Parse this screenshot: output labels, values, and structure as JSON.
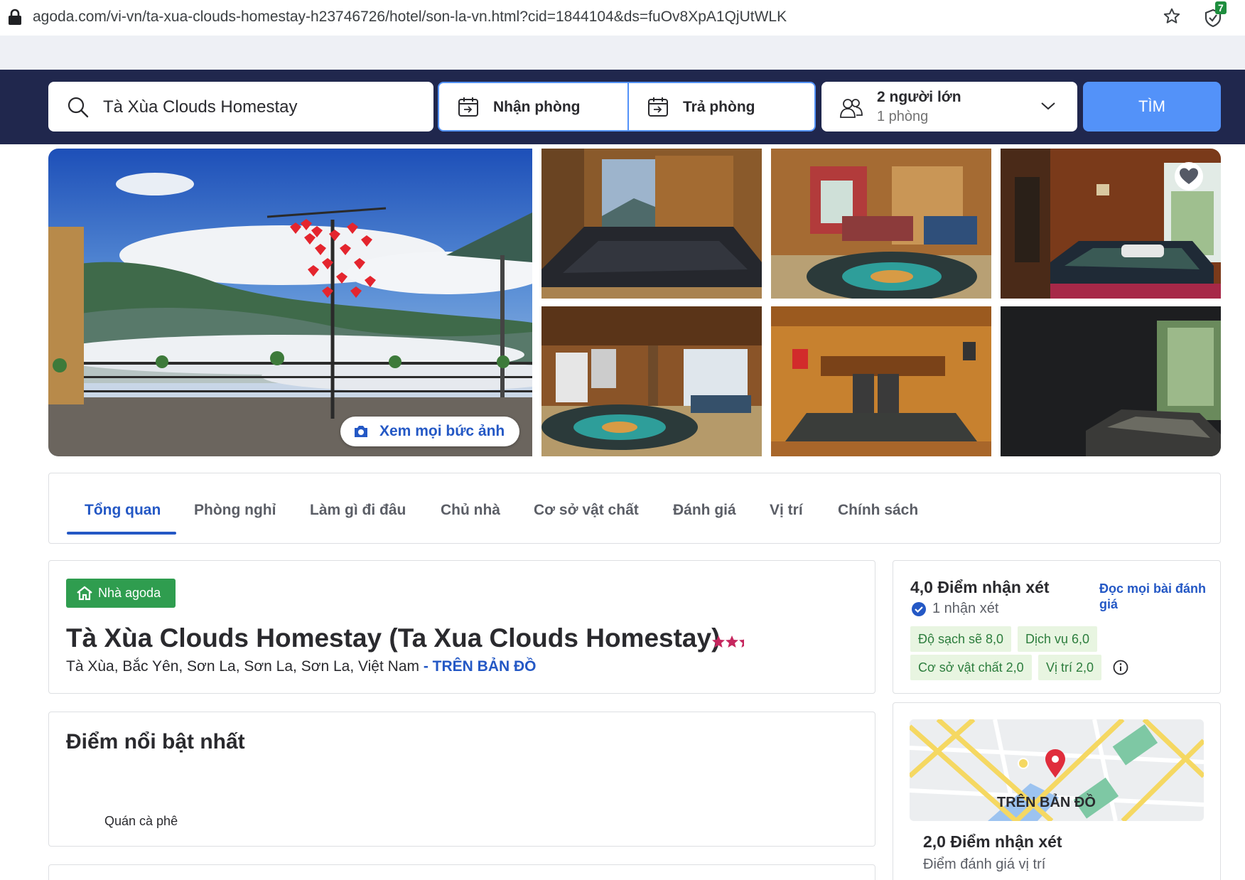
{
  "browser": {
    "url": "agoda.com/vi-vn/ta-xua-clouds-homestay-h23746726/hotel/son-la-vn.html?cid=1844104&ds=fuOv8XpA1QjUtWLK",
    "extension_badge": "7"
  },
  "search": {
    "destination": "Tà Xùa Clouds Homestay",
    "checkin_label": "Nhận phòng",
    "checkout_label": "Trả phòng",
    "guests": "2 người lớn",
    "rooms": "1 phòng",
    "button": "TÌM"
  },
  "gallery": {
    "view_all_label": "Xem mọi bức ảnh"
  },
  "tabs": [
    "Tổng quan",
    "Phòng nghỉ",
    "Làm gì đi đâu",
    "Chủ nhà",
    "Cơ sở vật chất",
    "Đánh giá",
    "Vị trí",
    "Chính sách"
  ],
  "hotel": {
    "badge": "Nhà agoda",
    "name": "Tà Xùa Clouds Homestay (Ta Xua Clouds Homestay)",
    "star_rating": 2.5,
    "address": "Tà Xùa, Bắc Yên, Sơn La, Sơn La, Sơn La, Việt Nam",
    "map_link": " - TRÊN BẢN ĐỒ"
  },
  "review": {
    "score_title": "4,0 Điểm nhận xét",
    "count": "1 nhận xét",
    "read_all": "Đọc mọi bài đánh giá",
    "subscores": [
      "Độ sạch sẽ 8,0",
      "Dịch vụ 6,0",
      "Cơ sở vật chất 2,0",
      "Vị trí 2,0"
    ]
  },
  "highlights": {
    "title": "Điểm nổi bật nhất",
    "items": [
      "Quán cà phê"
    ]
  },
  "map": {
    "label": "TRÊN BẢN ĐỒ",
    "score": "2,0 Điểm nhận xét",
    "sub": "Điểm đánh giá vị trí"
  },
  "colors": {
    "header_bg": "#20274d",
    "accent_blue": "#5392f9",
    "link_blue": "#2458c5",
    "agoda_green": "#2f9d4f",
    "star_pink": "#c6275e"
  }
}
